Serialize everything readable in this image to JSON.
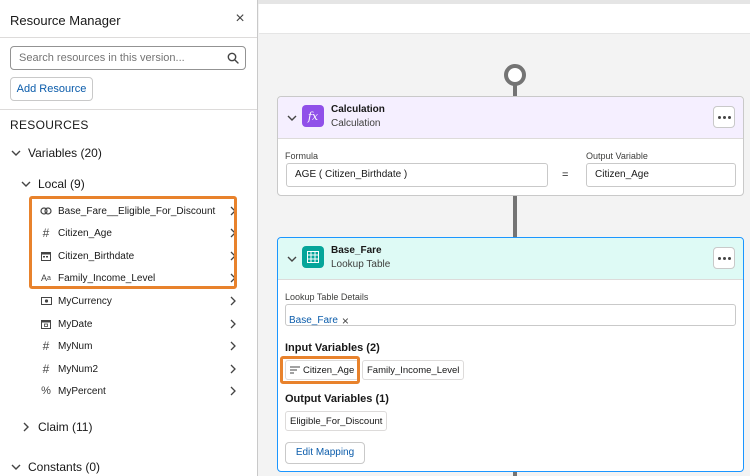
{
  "panel": {
    "title": "Resource Manager",
    "search_placeholder": "Search resources in this version...",
    "add_resource_label": "Add Resource",
    "resources_heading": "RESOURCES",
    "groups": {
      "variables": "Variables (20)",
      "local": "Local (9)",
      "claim": "Claim (11)",
      "constants": "Constants (0)"
    },
    "local_items": [
      {
        "label": "Base_Fare__Eligible_For_Discount",
        "icon": "link-icon"
      },
      {
        "label": "Citizen_Age",
        "icon": "number-icon"
      },
      {
        "label": "Citizen_Birthdate",
        "icon": "calendar-icon"
      },
      {
        "label": "Family_Income_Level",
        "icon": "text-icon"
      },
      {
        "label": "MyCurrency",
        "icon": "currency-icon"
      },
      {
        "label": "MyDate",
        "icon": "date-icon"
      },
      {
        "label": "MyNum",
        "icon": "number-icon"
      },
      {
        "label": "MyNum2",
        "icon": "number-icon"
      },
      {
        "label": "MyPercent",
        "icon": "percent-icon"
      }
    ]
  },
  "calculation": {
    "title": "Calculation",
    "subtitle": "Calculation",
    "formula_label": "Formula",
    "formula_value": "AGE ( Citizen_Birthdate )",
    "output_label": "Output Variable",
    "output_value": "Citizen_Age",
    "equals": "=",
    "icon_text": "fx",
    "color": "#9050e9"
  },
  "lookup": {
    "title": "Base_Fare",
    "subtitle": "Lookup Table",
    "details_label": "Lookup Table Details",
    "table_chip": "Base_Fare",
    "input_heading": "Input Variables (2)",
    "inputs": [
      "Citizen_Age",
      "Family_Income_Level"
    ],
    "output_heading": "Output Variables (1)",
    "outputs": [
      "Eligible_For_Discount"
    ],
    "edit_mapping_label": "Edit Mapping",
    "color": "#06a59a"
  },
  "highlight_color": "#e8822c"
}
